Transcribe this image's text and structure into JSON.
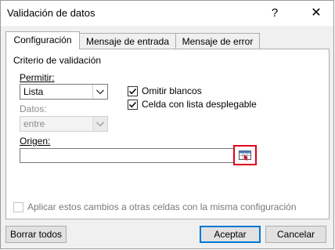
{
  "window": {
    "title": "Validación de datos",
    "help_glyph": "?",
    "close_glyph": "✕"
  },
  "tabs": [
    {
      "label": "Configuración",
      "active": true
    },
    {
      "label": "Mensaje de entrada",
      "active": false
    },
    {
      "label": "Mensaje de error",
      "active": false
    }
  ],
  "criteria": {
    "section_label": "Criterio de validación",
    "allow_label": "Permitir:",
    "allow_value": "Lista",
    "data_label": "Datos:",
    "data_value": "entre",
    "ignore_blank_label": "Omitir blancos",
    "ignore_blank_checked": true,
    "in_cell_dropdown_label": "Celda con lista desplegable",
    "in_cell_dropdown_checked": true,
    "source_label": "Origen:",
    "source_value": ""
  },
  "apply_all": {
    "label": "Aplicar estos cambios a otras celdas con la misma configuración",
    "checked": false
  },
  "buttons": {
    "clear_all": "Borrar todos",
    "ok": "Aceptar",
    "cancel": "Cancelar"
  },
  "colors": {
    "highlight_border": "#e0001b",
    "default_button_border": "#0078d7"
  }
}
